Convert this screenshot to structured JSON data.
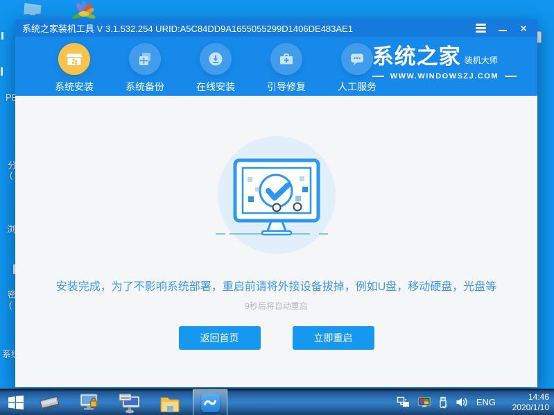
{
  "window": {
    "title": "系统之家装机工具 V 3.1.532.254 URID:A5C84DD9A1655055299D1406DE483AE1",
    "close_glyph": "✕"
  },
  "nav": {
    "items": [
      {
        "label": "系统安装",
        "icon": "install-box-icon",
        "active": true
      },
      {
        "label": "系统备份",
        "icon": "backup-copies-icon",
        "active": false
      },
      {
        "label": "在线安装",
        "icon": "download-circle-icon",
        "active": false
      },
      {
        "label": "引导修复",
        "icon": "toolbox-repair-icon",
        "active": false
      },
      {
        "label": "人工服务",
        "icon": "chat-service-icon",
        "active": false
      }
    ]
  },
  "logo": {
    "brand": "系统之家",
    "sub": "装机大师",
    "site": "WWW.WINDOWSZJ.COM"
  },
  "main": {
    "message": "安装完成，为了不影响系统部署，重启前请将外接设备拔掉，例如U盘，移动硬盘，光盘等",
    "countdown": "9秒后将自动重启",
    "home_button": "返回首页",
    "restart_button": "立即重启"
  },
  "taskbar": {
    "language": "ENG",
    "time": "14:46",
    "date": "2020/1/10"
  },
  "desktop": {
    "fragments": {
      "pe": "PE",
      "fen": "分",
      "paren1": "(",
      "liu": "浏",
      "mi": "密",
      "paren2": "(",
      "xitong": "系统"
    }
  },
  "icons": {
    "titlebar": [
      "hamburger-menu-icon",
      "minimize-icon",
      "close-icon"
    ],
    "taskbar": [
      "windows-start-icon",
      "ram-chip-icon",
      "monitor-lock-icon",
      "monitor-keyboard-icon",
      "folder-icon",
      "app-swoosh-icon"
    ],
    "tray": [
      "network-icon",
      "display-color-icon",
      "usb-icon",
      "speaker-icon"
    ]
  },
  "colors": {
    "desktop_blue": "#1095f0",
    "titlebar_blue": "#1679de",
    "navbar_blue": "#1689ea",
    "accent_gold": "#f6c44d",
    "content_bg": "#f5f6f7",
    "button_blue": "#1798f0",
    "message_blue": "#3e96e8",
    "illustration_stroke": "#2b97ef"
  }
}
